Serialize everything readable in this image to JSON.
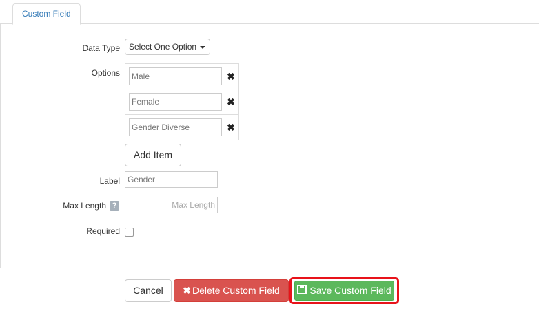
{
  "tabs": [
    {
      "label": "Custom Field"
    }
  ],
  "form": {
    "data_type": {
      "label": "Data Type",
      "selected": "Select One Option"
    },
    "options": {
      "label": "Options",
      "items": [
        {
          "value": "Male"
        },
        {
          "value": "Female"
        },
        {
          "value": "Gender Diverse"
        }
      ],
      "remove_glyph": "✖",
      "add_label": "Add Item"
    },
    "label_field": {
      "label": "Label",
      "value": "Gender"
    },
    "max_length": {
      "label": "Max Length",
      "placeholder": "Max Length",
      "help_glyph": "?"
    },
    "required": {
      "label": "Required",
      "checked": false
    }
  },
  "actions": {
    "cancel_label": "Cancel",
    "delete_label": "Delete Custom Field",
    "delete_icon": "✖",
    "save_label": "Save Custom Field",
    "save_icon": "floppy-disk-icon"
  },
  "colors": {
    "danger": "#d9534f",
    "success": "#5cb85c",
    "highlight": "#e8131a",
    "link": "#337ab7"
  }
}
